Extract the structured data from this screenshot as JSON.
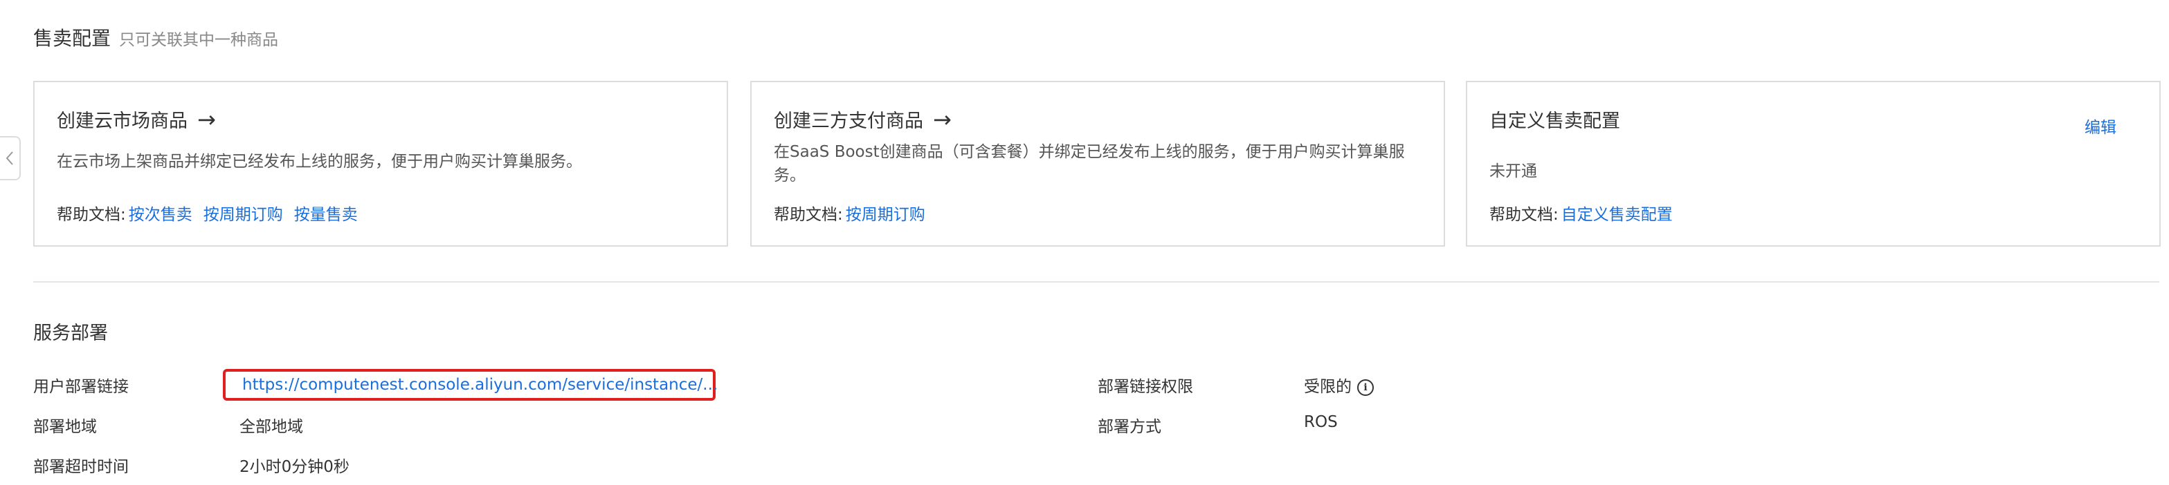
{
  "sales_config": {
    "title": "售卖配置",
    "hint": "只可关联其中一种商品",
    "cards": [
      {
        "title": "创建云市场商品",
        "arrow": "→",
        "desc": "在云市场上架商品并绑定已经发布上线的服务，便于用户购买计算巢服务。",
        "help_label": "帮助文档:",
        "links": [
          "按次售卖",
          "按周期订购",
          "按量售卖"
        ]
      },
      {
        "title": "创建三方支付商品",
        "arrow": "→",
        "desc": "在SaaS Boost创建商品（可含套餐）并绑定已经发布上线的服务，便于用户购买计算巢服务。",
        "help_label": "帮助文档:",
        "links": [
          "按周期订购"
        ]
      },
      {
        "title": "自定义售卖配置",
        "edit": "编辑",
        "status": "未开通",
        "help_label": "帮助文档:",
        "links": [
          "自定义售卖配置"
        ]
      }
    ]
  },
  "service_deploy": {
    "title": "服务部署",
    "fields": {
      "user_link_label": "用户部署链接",
      "user_link_value": "https://computenest.console.aliyun.com/service/instance/...",
      "region_label": "部署地域",
      "region_value": "全部地域",
      "timeout_label": "部署超时时间",
      "timeout_value": "2小时0分钟0秒",
      "permission_label": "部署链接权限",
      "permission_value": "受限的",
      "method_label": "部署方式",
      "method_value": "ROS"
    }
  },
  "icons": {
    "collapse": "chevron-left-icon",
    "info": "info-circle-icon"
  },
  "colors": {
    "link": "#1a6edc",
    "highlight_border": "#e02020"
  }
}
